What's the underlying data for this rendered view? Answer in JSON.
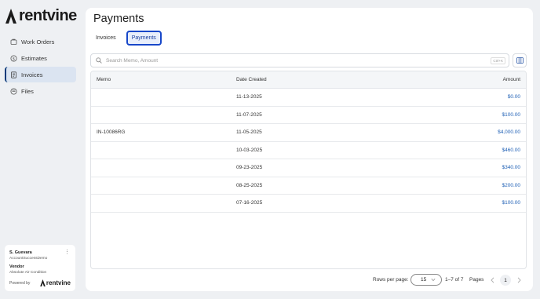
{
  "brand": {
    "name": "rentvine"
  },
  "sidebar": {
    "items": [
      {
        "label": "Work Orders",
        "icon": "wrench-icon"
      },
      {
        "label": "Estimates",
        "icon": "dollar-circle-icon"
      },
      {
        "label": "Invoices",
        "icon": "invoice-icon",
        "active": true
      },
      {
        "label": "Files",
        "icon": "folder-icon"
      }
    ],
    "user": {
      "name": "S. Guevara",
      "account": "AccountSuccessDemo",
      "role": "Vendor",
      "company": "Absolute Air Condition",
      "powered_by": "Powered by",
      "powered_brand": "rentvine"
    }
  },
  "main": {
    "title": "Payments",
    "tabs": [
      {
        "label": "Invoices",
        "active": false
      },
      {
        "label": "Payments",
        "active": true
      }
    ],
    "search": {
      "placeholder": "Search Memo, Amount",
      "shortcut": "Ctrl+K"
    },
    "table": {
      "headers": {
        "memo": "Memo",
        "date": "Date Created",
        "amount": "Amount"
      },
      "rows": [
        {
          "memo": "",
          "date": "11-13-2025",
          "amount": "$0.00"
        },
        {
          "memo": "",
          "date": "11-07-2025",
          "amount": "$100.00"
        },
        {
          "memo": "IN-10086RG",
          "date": "11-05-2025",
          "amount": "$4,000.00"
        },
        {
          "memo": "",
          "date": "10-03-2025",
          "amount": "$460.00"
        },
        {
          "memo": "",
          "date": "09-23-2025",
          "amount": "$340.00"
        },
        {
          "memo": "",
          "date": "08-25-2025",
          "amount": "$200.00"
        },
        {
          "memo": "",
          "date": "07-16-2025",
          "amount": "$100.00"
        }
      ]
    },
    "pagination": {
      "rows_per_page_label": "Rows per page:",
      "rows_per_page": "15",
      "range": "1–7 of 7",
      "pages_label": "Pages",
      "current_page": "1"
    }
  },
  "colors": {
    "accent": "#1747c9",
    "link": "#1e5fb5",
    "active_nav": "#dbe4f1"
  }
}
